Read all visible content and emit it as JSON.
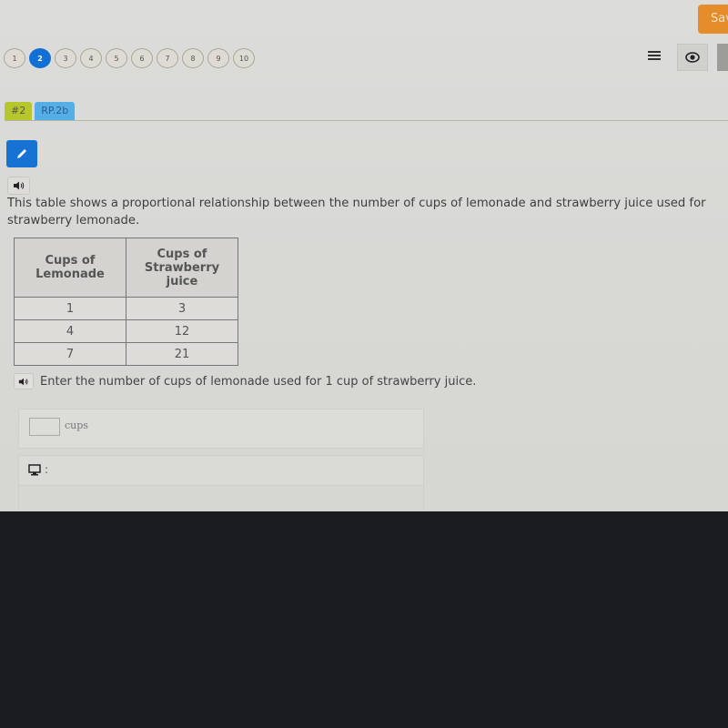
{
  "topbar": {
    "save_label": "Save"
  },
  "question_nav": {
    "items": [
      "1",
      "2",
      "3",
      "4",
      "5",
      "6",
      "7",
      "8",
      "9",
      "10"
    ],
    "active": "2"
  },
  "toolbar": {
    "menu_icon": "list-icon",
    "eye_icon": "eye-icon"
  },
  "tags": {
    "number": "#2",
    "standard": "RP.2b"
  },
  "tools": {
    "pencil_icon": "pencil-icon",
    "audio_icon": "speaker-icon"
  },
  "question": {
    "prompt": "This table shows a proportional relationship between the number of cups of lemonade and strawberry juice used for strawberry lemonade.",
    "table": {
      "headers": [
        "Cups of Lemonade",
        "Cups of Strawberry juice"
      ],
      "rows": [
        [
          "1",
          "3"
        ],
        [
          "4",
          "12"
        ],
        [
          "7",
          "21"
        ]
      ]
    },
    "sub_prompt": "Enter the number of cups of lemonade used for 1 cup of strawberry juice.",
    "answer": {
      "value": "",
      "unit": "cups"
    },
    "calculator_label": ":"
  },
  "colors": {
    "accent_blue": "#1672d3",
    "save_orange": "#e48d2a",
    "tag_green": "#b5c72a",
    "tag_blue": "#56aee6"
  }
}
